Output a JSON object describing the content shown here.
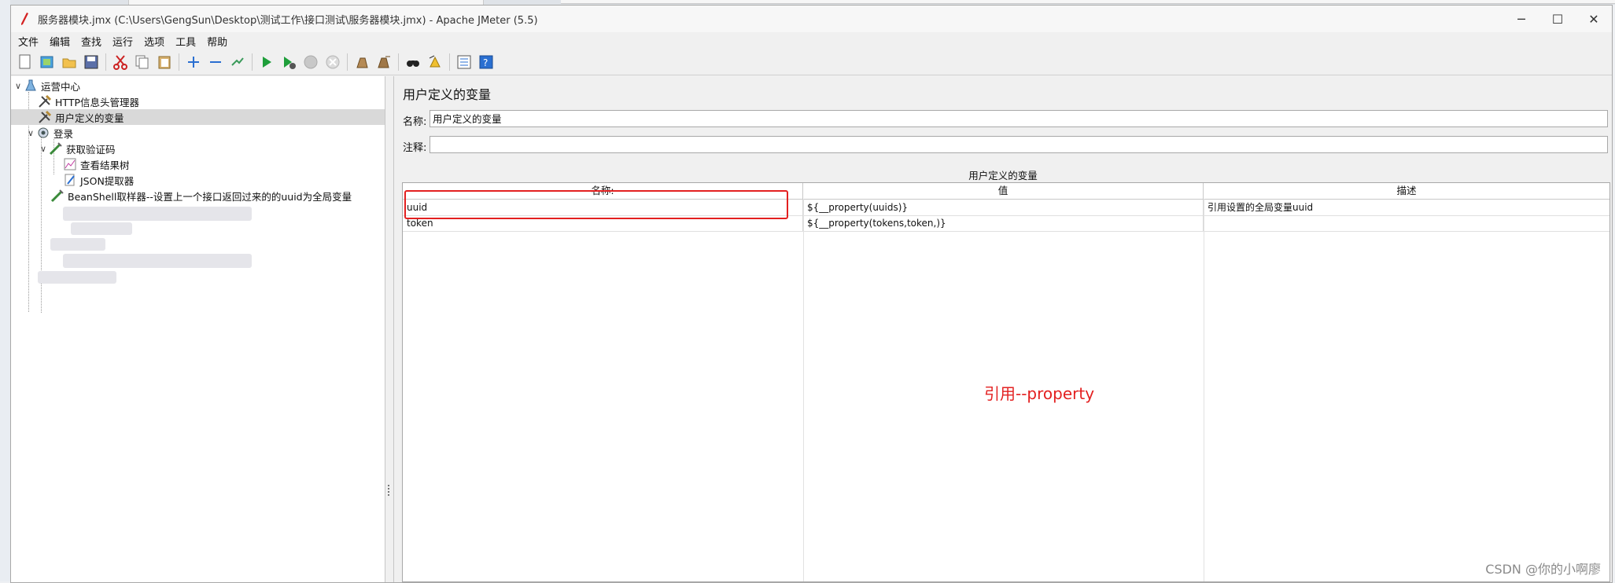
{
  "window": {
    "title": "服务器模块.jmx (C:\\Users\\GengSun\\Desktop\\测试工作\\接口测试\\服务器模块.jmx) - Apache JMeter (5.5)",
    "controls": {
      "minimize": "─",
      "maximize": "☐",
      "close": "✕"
    }
  },
  "menubar": [
    "文件",
    "编辑",
    "查找",
    "运行",
    "选项",
    "工具",
    "帮助"
  ],
  "toolbar": {
    "icons": [
      "new-icon",
      "templates-icon",
      "open-icon",
      "save-icon",
      "cut-icon",
      "copy-icon",
      "paste-icon",
      "expand-icon",
      "collapse-icon",
      "toggle-icon",
      "start-icon",
      "start-no-pause-icon",
      "stop-icon",
      "shutdown-icon",
      "clear-icon",
      "clear-all-icon",
      "search-icon",
      "reset-search-icon",
      "function-helper-icon",
      "help-icon"
    ]
  },
  "tree": {
    "nodes": [
      {
        "label": "运营中心",
        "icon": "test-plan-icon"
      },
      {
        "label": "HTTP信息头管理器",
        "icon": "config-element-icon"
      },
      {
        "label": "用户定义的变量",
        "icon": "config-element-icon"
      },
      {
        "label": "登录",
        "icon": "thread-group-icon"
      },
      {
        "label": "获取验证码",
        "icon": "sampler-icon"
      },
      {
        "label": "查看结果树",
        "icon": "listener-icon"
      },
      {
        "label": "JSON提取器",
        "icon": "extractor-icon"
      },
      {
        "label": "BeanShell取样器--设置上一个接口返回过来的的uuid为全局变量",
        "icon": "sampler-icon"
      }
    ]
  },
  "panel": {
    "title": "用户定义的变量",
    "name_label": "名称:",
    "name_value": "用户定义的变量",
    "comment_label": "注释:",
    "comment_value": "",
    "table_caption": "用户定义的变量",
    "columns": [
      "名称:",
      "值",
      "描述"
    ],
    "rows": [
      {
        "name": "uuid",
        "value": "${__property(uuids)}",
        "desc": "引用设置的全局变量uuid"
      },
      {
        "name": "token",
        "value": "${__property(tokens,token,)}",
        "desc": ""
      }
    ],
    "annotation": "引用--property",
    "highlight_color": "#e32020"
  },
  "watermark": "CSDN @你的小啊廖"
}
